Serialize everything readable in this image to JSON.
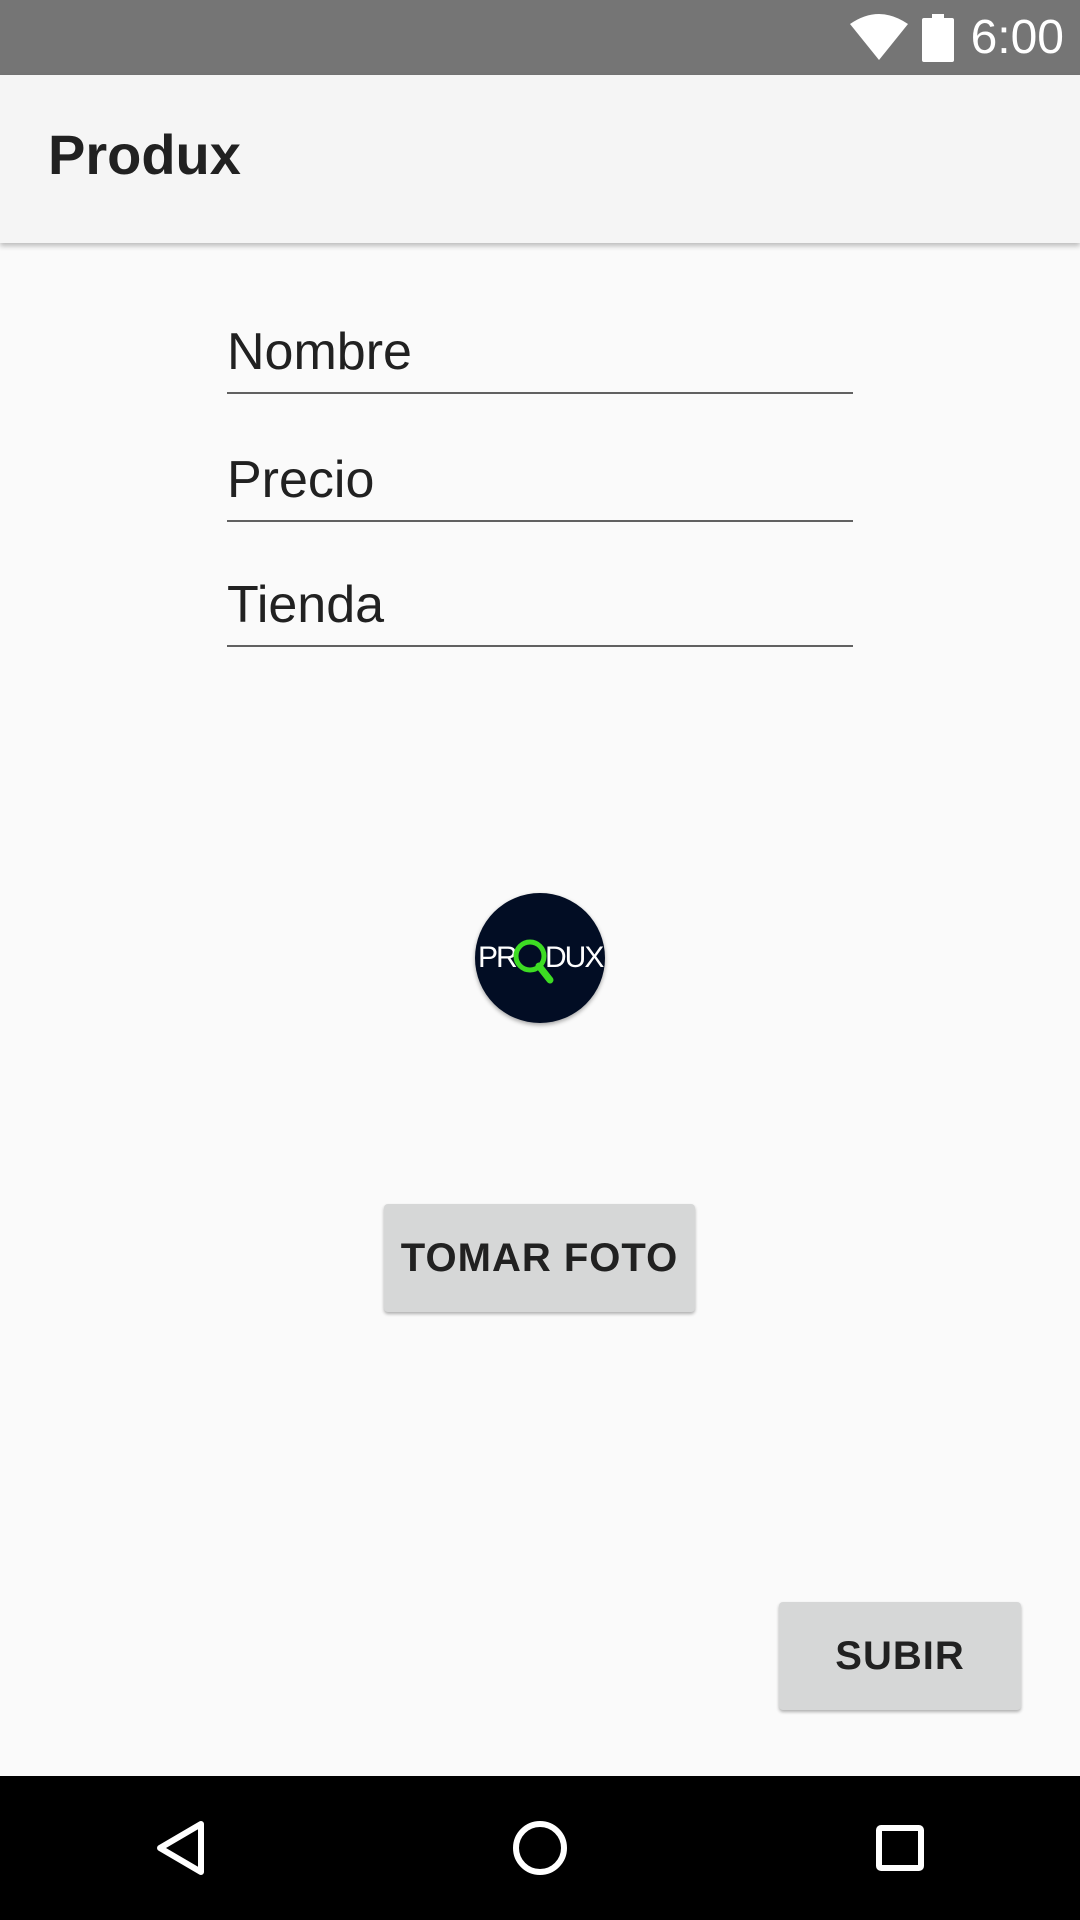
{
  "status_bar": {
    "time": "6:00",
    "icons": [
      "wifi-icon",
      "battery-icon"
    ]
  },
  "app_bar": {
    "title": "Produx"
  },
  "form": {
    "nombre_placeholder": "Nombre",
    "precio_placeholder": "Precio",
    "tienda_placeholder": "Tienda"
  },
  "logo": {
    "text_left": "PR",
    "text_right": "DUX",
    "accent_color": "#3ddc23",
    "background_color": "#020d24"
  },
  "buttons": {
    "take_photo": "TOMAR FOTO",
    "upload": "SUBIR"
  },
  "nav_bar": {
    "icons": [
      "back-icon",
      "home-icon",
      "recents-icon"
    ]
  },
  "colors": {
    "status_bar": "#757575",
    "app_bar": "#f5f5f5",
    "background": "#fafafa",
    "button": "#d6d7d7",
    "nav_bar": "#000000"
  }
}
